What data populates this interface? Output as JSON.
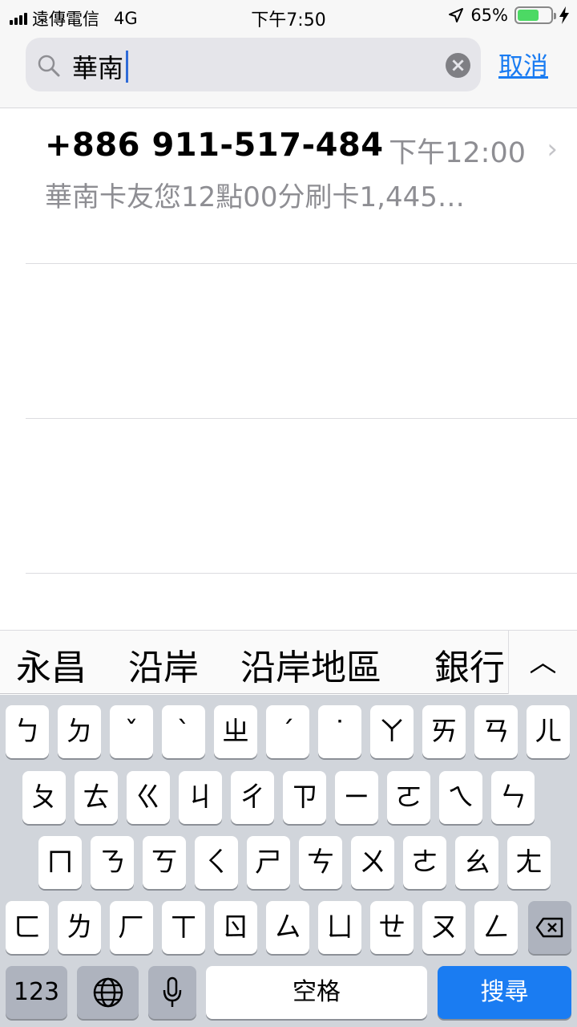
{
  "status_bar": {
    "carrier": "遠傳電信",
    "network": "4G",
    "time": "下午7:50",
    "battery": "65%",
    "battery_level": 0.65
  },
  "search": {
    "query": "華南",
    "cancel_label": "取消"
  },
  "results": [
    {
      "sender": "+886 911-517-484",
      "time": "下午12:00",
      "preview": "華南卡友您12點00分刷卡1,445…"
    }
  ],
  "candidates": [
    "永昌",
    "沿岸",
    "沿岸地區",
    "銀行"
  ],
  "keyboard": {
    "row1": [
      "ㄅ",
      "ㄉ",
      "ˇ",
      "ˋ",
      "ㄓ",
      "ˊ",
      "˙",
      "ㄚ",
      "ㄞ",
      "ㄢ",
      "ㄦ"
    ],
    "row2": [
      "ㄆ",
      "ㄊ",
      "ㄍ",
      "ㄐ",
      "ㄔ",
      "ㄗ",
      "ㄧ",
      "ㄛ",
      "ㄟ",
      "ㄣ"
    ],
    "row3": [
      "ㄇ",
      "ㄋ",
      "ㄎ",
      "ㄑ",
      "ㄕ",
      "ㄘ",
      "ㄨ",
      "ㄜ",
      "ㄠ",
      "ㄤ"
    ],
    "row4": [
      "ㄈ",
      "ㄌ",
      "ㄏ",
      "ㄒ",
      "ㄖ",
      "ㄙ",
      "ㄩ",
      "ㄝ",
      "ㄡ",
      "ㄥ"
    ],
    "numbers_label": "123",
    "space_label": "空格",
    "search_label": "搜尋"
  }
}
